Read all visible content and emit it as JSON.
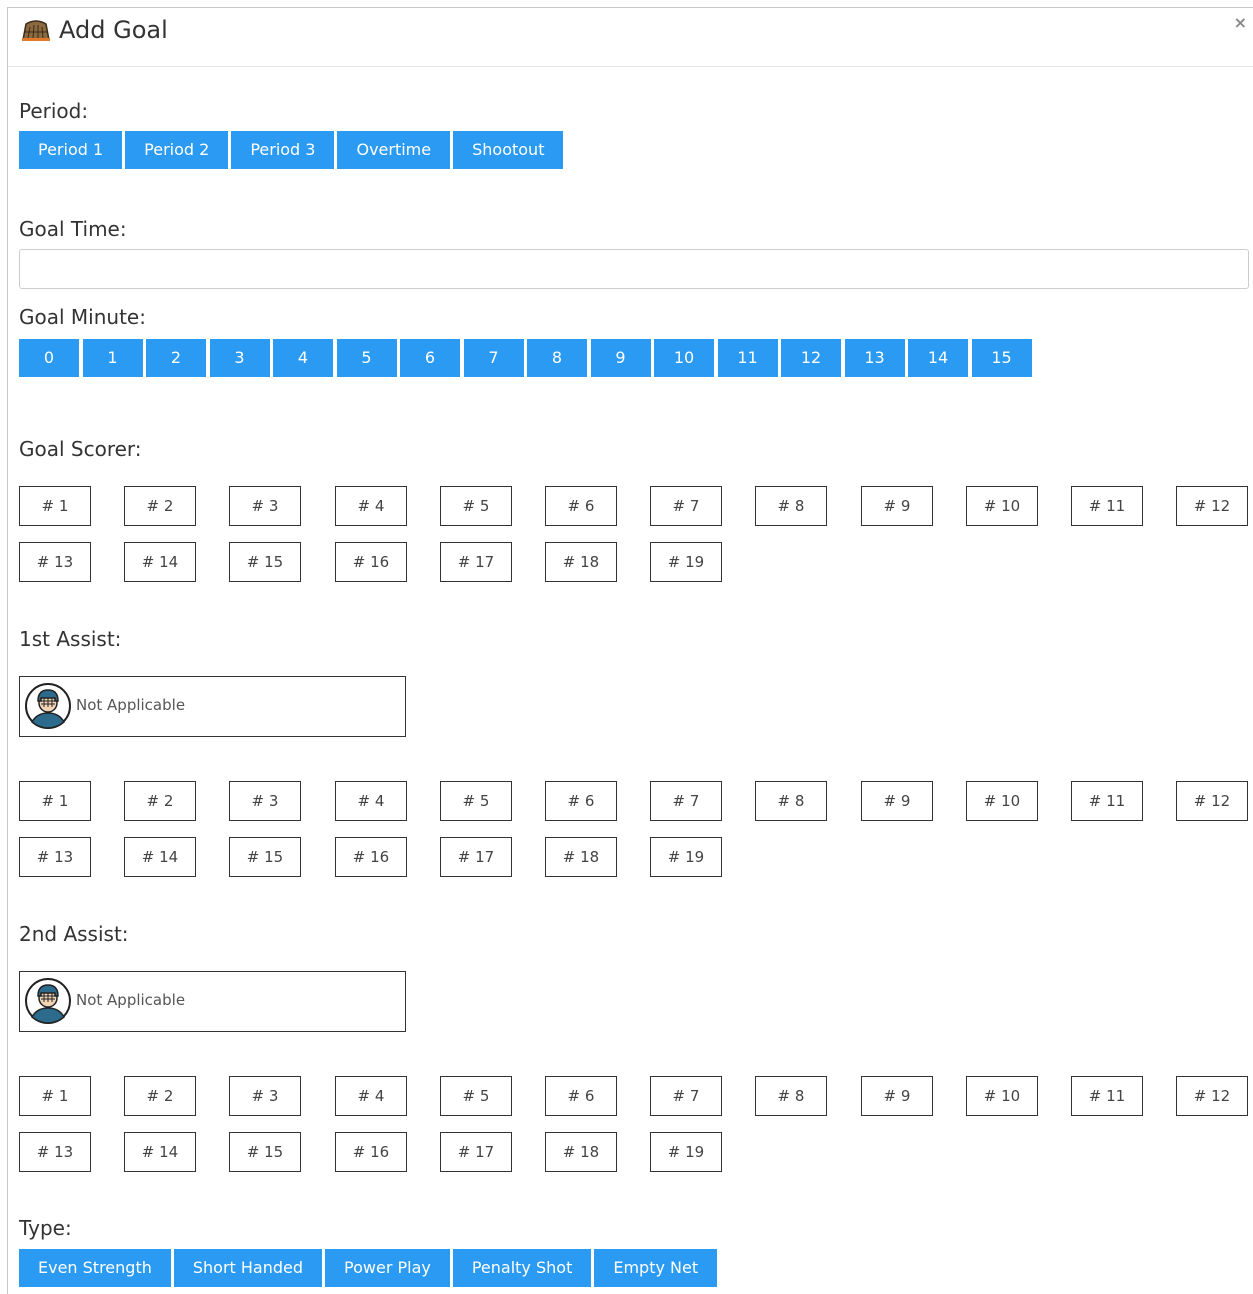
{
  "dialog": {
    "title": "Add Goal",
    "close_label": "×"
  },
  "period": {
    "label": "Period:",
    "options": [
      "Period 1",
      "Period 2",
      "Period 3",
      "Overtime",
      "Shootout"
    ]
  },
  "goal_time": {
    "label": "Goal Time:",
    "value": "",
    "placeholder": ""
  },
  "goal_minute": {
    "label": "Goal Minute:",
    "options": [
      "0",
      "1",
      "2",
      "3",
      "4",
      "5",
      "6",
      "7",
      "8",
      "9",
      "10",
      "11",
      "12",
      "13",
      "14",
      "15"
    ]
  },
  "goal_scorer": {
    "label": "Goal Scorer:",
    "players": [
      "# 1",
      "# 2",
      "# 3",
      "# 4",
      "# 5",
      "# 6",
      "# 7",
      "# 8",
      "# 9",
      "# 10",
      "# 11",
      "# 12",
      "# 13",
      "# 14",
      "# 15",
      "# 16",
      "# 17",
      "# 18",
      "# 19"
    ]
  },
  "assist1": {
    "label": "1st Assist:",
    "not_applicable": "Not Applicable",
    "players": [
      "# 1",
      "# 2",
      "# 3",
      "# 4",
      "# 5",
      "# 6",
      "# 7",
      "# 8",
      "# 9",
      "# 10",
      "# 11",
      "# 12",
      "# 13",
      "# 14",
      "# 15",
      "# 16",
      "# 17",
      "# 18",
      "# 19"
    ]
  },
  "assist2": {
    "label": "2nd Assist:",
    "not_applicable": "Not Applicable",
    "players": [
      "# 1",
      "# 2",
      "# 3",
      "# 4",
      "# 5",
      "# 6",
      "# 7",
      "# 8",
      "# 9",
      "# 10",
      "# 11",
      "# 12",
      "# 13",
      "# 14",
      "# 15",
      "# 16",
      "# 17",
      "# 18",
      "# 19"
    ]
  },
  "type": {
    "label": "Type:",
    "options": [
      "Even Strength",
      "Short Handed",
      "Power Play",
      "Penalty Shot",
      "Empty Net"
    ]
  },
  "colors": {
    "accent": "#2b9af3",
    "border": "#333333"
  },
  "icons": {
    "title": "hockey-goal-icon",
    "avatar": "hockey-player-avatar-icon"
  }
}
